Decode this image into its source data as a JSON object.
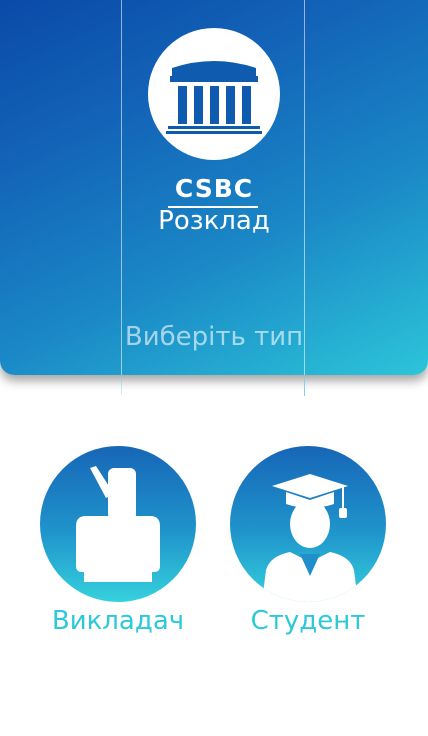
{
  "app": {
    "title": "CSBC",
    "subtitle": "Розклад"
  },
  "prompt": "Виберіть тип",
  "roles": [
    {
      "label": "Викладач",
      "icon": "teacher-icon"
    },
    {
      "label": "Студент",
      "icon": "student-graduate-icon"
    }
  ],
  "colors": {
    "header_start": "#0a4aa8",
    "header_end": "#2cc5d9",
    "accent": "#2cc9d8"
  }
}
